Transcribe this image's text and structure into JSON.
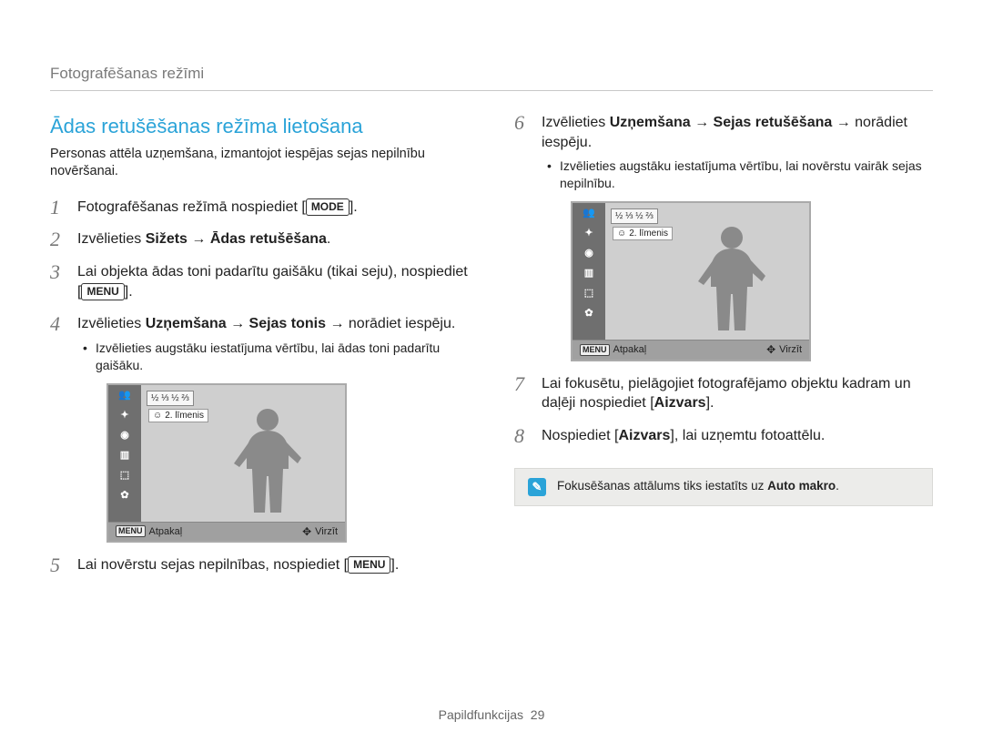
{
  "header": {
    "breadcrumb": "Fotografēšanas režīmi"
  },
  "section": {
    "title": "Ādas retušēšanas režīma lietošana",
    "intro": "Personas attēla uzņemšana, izmantojot iespējas sejas nepilnību novēršanai."
  },
  "steps": {
    "s1_a": "Fotografēšanas režīmā nospiediet [",
    "s1_btn": "MODE",
    "s1_b": "].",
    "s2_a": "Izvēlieties ",
    "s2_bold": "Sižets → Ādas retušēšana",
    "s2_b": ".",
    "s3_a": "Lai objekta ādas toni padarītu gaišāku (tikai seju), nospiediet [",
    "s3_btn": "MENU",
    "s3_b": "].",
    "s4_a": "Izvēlieties ",
    "s4_bold": "Uzņemšana → Sejas tonis",
    "s4_b": " → norādiet iespēju.",
    "s4_sub": "Izvēlieties augstāku iestatījuma vērtību, lai ādas toni padarītu gaišāku.",
    "s5_a": "Lai novērstu sejas nepilnības, nospiediet [",
    "s5_btn": "MENU",
    "s5_b": "].",
    "s6_a": "Izvēlieties ",
    "s6_bold": "Uzņemšana → Sejas retušēšana",
    "s6_b": " → norādiet iespēju.",
    "s6_sub": "Izvēlieties augstāku iestatījuma vērtību, lai novērstu vairāk sejas nepilnību.",
    "s7_a": "Lai fokusētu, pielāgojiet fotografējamo objektu kadram un daļēji nospiediet [",
    "s7_bold": "Aizvars",
    "s7_b": "].",
    "s8_a": "Nospiediet [",
    "s8_bold": "Aizvars",
    "s8_b": "], lai uzņemtu fotoattēlu."
  },
  "camshot": {
    "level_label": "2. līmenis",
    "icons": [
      "👥",
      "✦",
      "◉",
      "▥",
      "⬚",
      "✿"
    ],
    "bolt_row": "½ ⅓ ½ ⅔",
    "bottom_left_icon": "MENU",
    "bottom_left": "Atpakaļ",
    "bottom_right": "Virzīt"
  },
  "note": {
    "text_a": "Fokusēšanas attālums tiks iestatīts uz ",
    "text_bold": "Auto makro",
    "text_b": "."
  },
  "footer": {
    "label": "Papildfunkcijas",
    "page": "29"
  }
}
